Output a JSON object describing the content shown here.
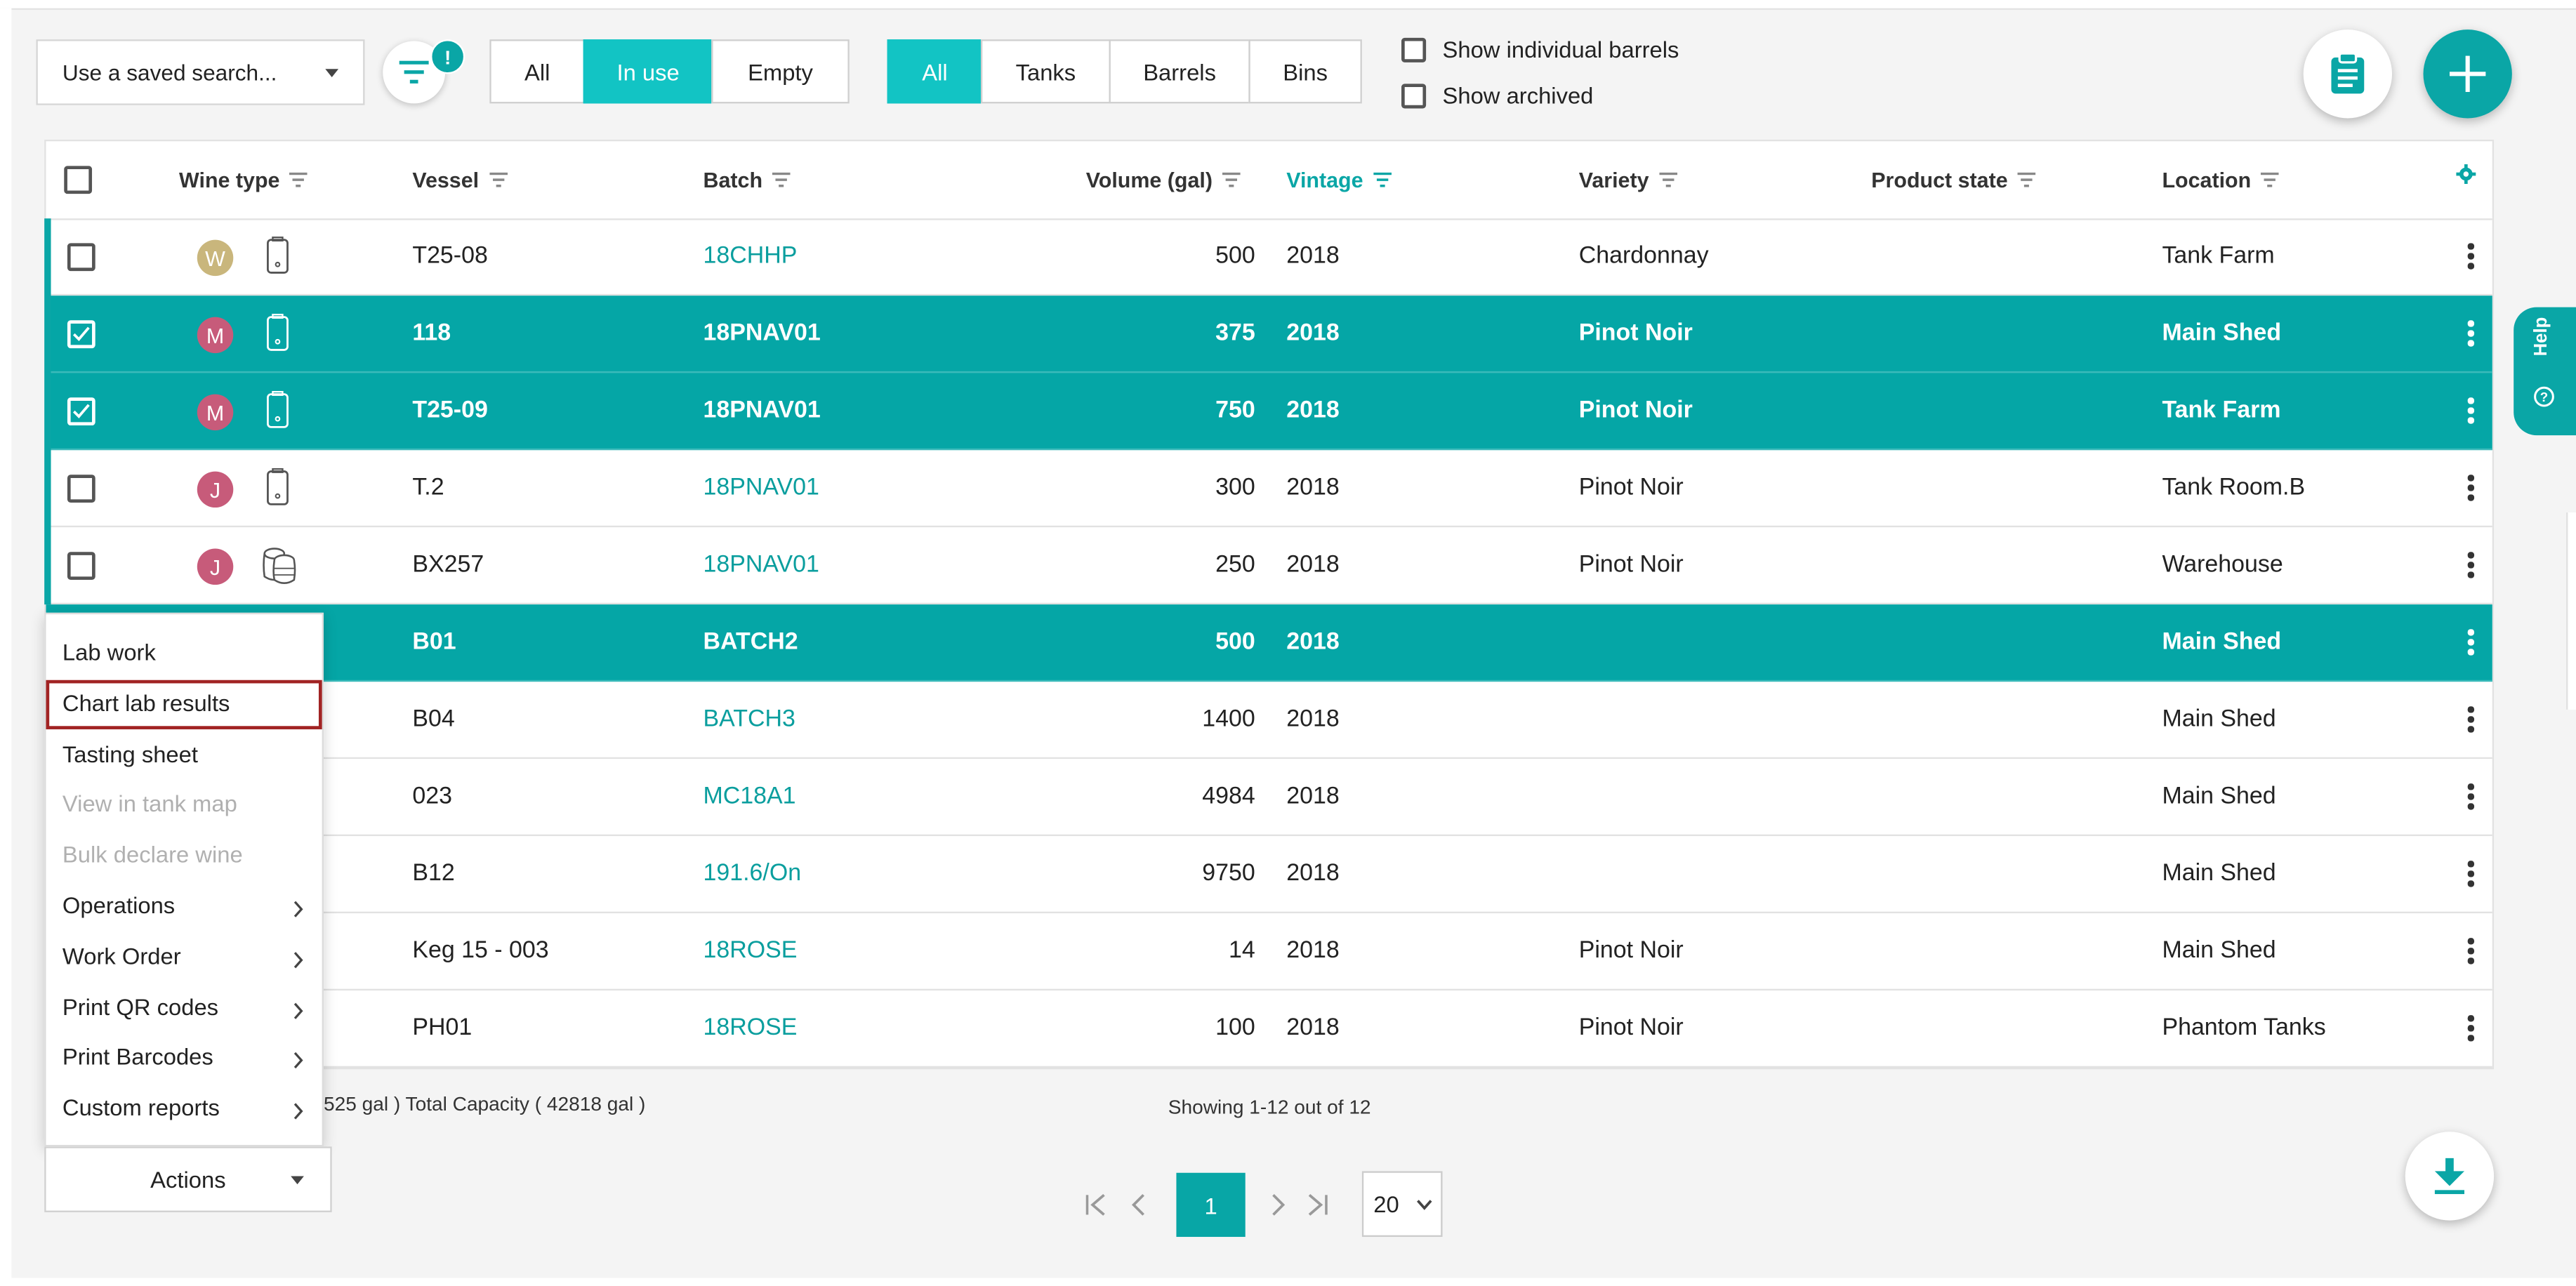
{
  "toolbar": {
    "saved_search": "Use a saved search...",
    "filter_badge": "!",
    "usage_filters": [
      "All",
      "In use",
      "Empty"
    ],
    "usage_active": "In use",
    "vessel_filters": [
      "All",
      "Tanks",
      "Barrels",
      "Bins"
    ],
    "vessel_active": "All",
    "show_individual_barrels": "Show individual barrels",
    "show_archived": "Show archived"
  },
  "help": {
    "label": "Help"
  },
  "table": {
    "headers": {
      "wine_type": "Wine type",
      "vessel": "Vessel",
      "batch": "Batch",
      "volume": "Volume (gal)",
      "vintage": "Vintage",
      "variety": "Variety",
      "product_state": "Product state",
      "location": "Location"
    },
    "rows": [
      {
        "selected": false,
        "wine_type": "W",
        "wine_color": "#c9b67c",
        "vessel_icon": "tank-icon",
        "vessel": "T25-08",
        "batch": "18CHHP",
        "volume": "500",
        "vintage": "2018",
        "variety": "Chardonnay",
        "product_state": "",
        "location": "Tank Farm"
      },
      {
        "selected": true,
        "wine_type": "M",
        "wine_color": "#c75b7a",
        "vessel_icon": "tank-icon",
        "vessel": "118",
        "batch": "18PNAV01",
        "volume": "375",
        "vintage": "2018",
        "variety": "Pinot Noir",
        "product_state": "",
        "location": "Main Shed"
      },
      {
        "selected": true,
        "wine_type": "M",
        "wine_color": "#c75b7a",
        "vessel_icon": "tank-icon",
        "vessel": "T25-09",
        "batch": "18PNAV01",
        "volume": "750",
        "vintage": "2018",
        "variety": "Pinot Noir",
        "product_state": "",
        "location": "Tank Farm"
      },
      {
        "selected": false,
        "wine_type": "J",
        "wine_color": "#c75b7a",
        "vessel_icon": "tank-icon",
        "vessel": "T.2",
        "batch": "18PNAV01",
        "volume": "300",
        "vintage": "2018",
        "variety": "Pinot Noir",
        "product_state": "",
        "location": "Tank Room.B"
      },
      {
        "selected": false,
        "wine_type": "J",
        "wine_color": "#c75b7a",
        "vessel_icon": "barrels-icon",
        "vessel": "BX257",
        "batch": "18PNAV01",
        "volume": "250",
        "vintage": "2018",
        "variety": "Pinot Noir",
        "product_state": "",
        "location": "Warehouse"
      },
      {
        "selected": true,
        "wine_type": "",
        "wine_color": "",
        "vessel_icon": "",
        "vessel": "B01",
        "batch": "BATCH2",
        "volume": "500",
        "vintage": "2018",
        "variety": "",
        "product_state": "",
        "location": "Main Shed"
      },
      {
        "selected": false,
        "wine_type": "",
        "wine_color": "",
        "vessel_icon": "",
        "vessel": "B04",
        "batch": "BATCH3",
        "volume": "1400",
        "vintage": "2018",
        "variety": "",
        "product_state": "",
        "location": "Main Shed"
      },
      {
        "selected": false,
        "wine_type": "",
        "wine_color": "",
        "vessel_icon": "",
        "vessel": "023",
        "batch": "MC18A1",
        "volume": "4984",
        "vintage": "2018",
        "variety": "",
        "product_state": "",
        "location": "Main Shed"
      },
      {
        "selected": false,
        "wine_type": "",
        "wine_color": "",
        "vessel_icon": "",
        "vessel": "B12",
        "batch": "191.6/On",
        "volume": "9750",
        "vintage": "2018",
        "variety": "",
        "product_state": "",
        "location": "Main Shed"
      },
      {
        "selected": false,
        "wine_type": "",
        "wine_color": "",
        "vessel_icon": "",
        "vessel": "Keg 15 - 003",
        "batch": "18ROSE",
        "volume": "14",
        "vintage": "2018",
        "variety": "Pinot Noir",
        "product_state": "",
        "location": "Main Shed"
      },
      {
        "selected": false,
        "wine_type": "",
        "wine_color": "",
        "vessel_icon": "",
        "vessel": "PH01",
        "batch": "18ROSE",
        "volume": "100",
        "vintage": "2018",
        "variety": "Pinot Noir",
        "product_state": "",
        "location": "Phantom Tanks"
      }
    ]
  },
  "context_menu": {
    "items": [
      {
        "label": "Lab work",
        "disabled": false,
        "submenu": false
      },
      {
        "label": "Chart lab results",
        "disabled": false,
        "submenu": false,
        "highlighted": true
      },
      {
        "label": "Tasting sheet",
        "disabled": false,
        "submenu": false
      },
      {
        "label": "View in tank map",
        "disabled": true,
        "submenu": false
      },
      {
        "label": "Bulk declare wine",
        "disabled": true,
        "submenu": false
      },
      {
        "label": "Operations",
        "disabled": false,
        "submenu": true
      },
      {
        "label": "Work Order",
        "disabled": false,
        "submenu": true
      },
      {
        "label": "Print QR codes",
        "disabled": false,
        "submenu": true
      },
      {
        "label": "Print Barcodes",
        "disabled": false,
        "submenu": true
      },
      {
        "label": "Custom reports",
        "disabled": false,
        "submenu": true
      }
    ]
  },
  "footer": {
    "summary": "525 gal ) Total Capacity ( 42818 gal )",
    "showing": "Showing 1-12 out of 12",
    "actions_label": "Actions",
    "current_page": "1",
    "page_size": "20"
  },
  "colors": {
    "accent": "#0aa6a6",
    "selected_row": "#05a6a6",
    "menu_highlight_border": "#a12323"
  }
}
